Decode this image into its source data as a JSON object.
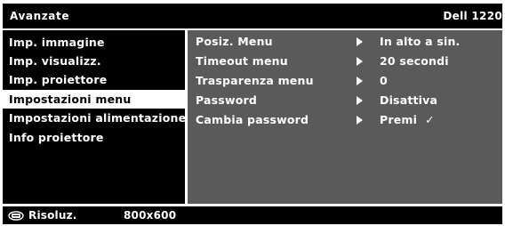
{
  "header": {
    "section_title": "Avanzate",
    "model": "Dell 1220"
  },
  "sidebar": {
    "items": [
      {
        "label": "Imp. immagine"
      },
      {
        "label": "Imp. visualizz."
      },
      {
        "label": "Imp. proiettore"
      },
      {
        "label": "Impostazioni menu",
        "selected": true
      },
      {
        "label": "Impostazioni alimentazione"
      },
      {
        "label": "Info proiettore"
      }
    ]
  },
  "settings": {
    "rows": [
      {
        "name": "Posiz. Menu",
        "value": "In alto a sin."
      },
      {
        "name": "Timeout menu",
        "value": "20 secondi"
      },
      {
        "name": "Trasparenza menu",
        "value": "0"
      },
      {
        "name": "Password",
        "value": "Disattiva"
      },
      {
        "name": "Cambia password",
        "value": "Premi",
        "check": "✓"
      }
    ]
  },
  "footer": {
    "icon": "input-source-icon",
    "label": "Risoluz.",
    "value": "800x600"
  },
  "colors": {
    "background": "#ffffff",
    "osd_black": "#000000",
    "content_gray": "#5a5a5a",
    "text": "#ffffff",
    "selected_text": "#000000"
  }
}
